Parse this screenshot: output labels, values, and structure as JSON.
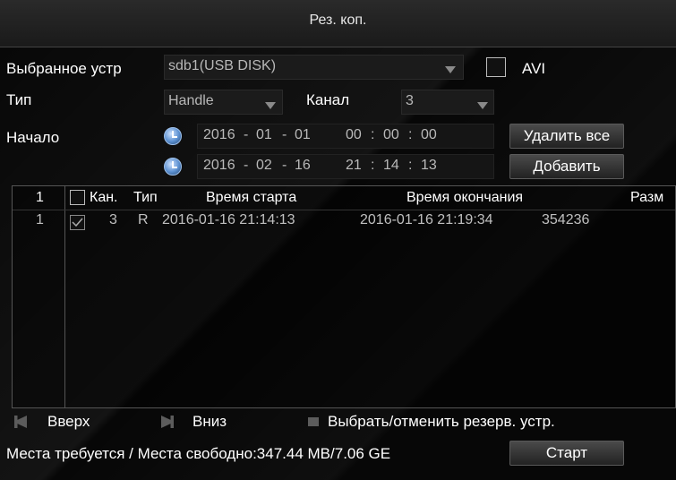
{
  "window": {
    "title": "Рез. коп."
  },
  "device": {
    "label": "Выбранное устр",
    "value": "sdb1(USB DISK)",
    "avi_label": "AVI"
  },
  "type": {
    "label": "Тип",
    "value": "Handle"
  },
  "channel": {
    "label": "Канал",
    "value": "3"
  },
  "start": {
    "label": "Начало",
    "from": {
      "year": "2016",
      "month": "01",
      "day": "01",
      "hh": "00",
      "mm": "00",
      "ss": "00"
    },
    "to": {
      "year": "2016",
      "month": "02",
      "day": "16",
      "hh": "21",
      "mm": "14",
      "ss": "13"
    }
  },
  "buttons": {
    "delete_all": "Удалить все",
    "add": "Добавить",
    "start": "Старт"
  },
  "table": {
    "headers": {
      "num": "1",
      "ch": "Кан.",
      "type": "Тип",
      "start": "Время старта",
      "end": "Время окончания",
      "size": "Разм"
    },
    "rows": [
      {
        "num": "1",
        "ch": "3",
        "type": "R",
        "start": "2016-01-16 21:14:13",
        "end": "2016-01-16 21:19:34",
        "size": "354236"
      }
    ]
  },
  "nav": {
    "up": "Вверх",
    "down": "Вниз",
    "select": "Выбрать/отменить резерв. устр."
  },
  "space": {
    "text": "Места требуется / Места свободно:347.44 MB/7.06 GE"
  },
  "colors": {
    "background": "#070707",
    "border": "#555555",
    "text": "#ffffff",
    "field": "#b9b9b9"
  }
}
